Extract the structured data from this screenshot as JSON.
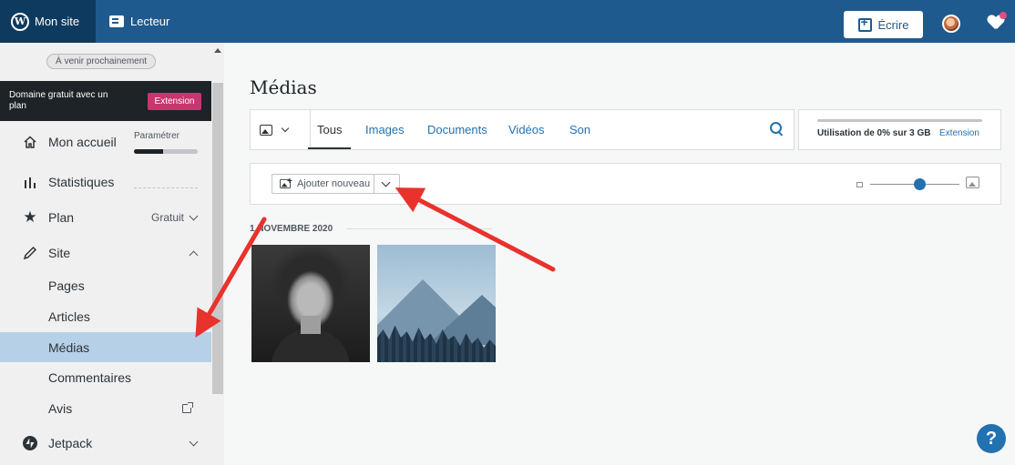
{
  "topbar": {
    "my_site": "Mon site",
    "reader": "Lecteur",
    "write": "Écrire"
  },
  "sidebar": {
    "upcoming_badge": "À venir prochainement",
    "domain_promo": {
      "text": "Domaine gratuit avec un plan",
      "button": "Extension"
    },
    "setup_label": "Paramétrer",
    "setup_progress": 0.45,
    "items": [
      {
        "label": "Mon accueil",
        "icon": "home-icon"
      },
      {
        "label": "Statistiques",
        "icon": "stats-icon"
      },
      {
        "label": "Plan",
        "icon": "star-icon",
        "right": "Gratuit"
      },
      {
        "label": "Site",
        "icon": "pencil-icon"
      }
    ],
    "site_subitems": [
      "Pages",
      "Articles",
      "Médias",
      "Commentaires",
      "Avis"
    ],
    "jetpack": "Jetpack"
  },
  "main": {
    "title": "Médias",
    "tabs": [
      "Tous",
      "Images",
      "Documents",
      "Vidéos",
      "Son"
    ],
    "active_tab": "Tous",
    "usage": {
      "text": "Utilisation de 0% sur 3 GB",
      "link": "Extension",
      "percent": 0
    },
    "add_new": "Ajouter nouveau",
    "zoom_level": 0.55,
    "date_group": "1 NOVEMBRE 2020",
    "media_items": [
      {
        "type": "image",
        "subject": "portrait"
      },
      {
        "type": "image",
        "subject": "mountains"
      }
    ]
  },
  "help": "?",
  "colors": {
    "topbar": "#1e5a8e",
    "accent": "#2271b1",
    "promo_button": "#c9356e",
    "active_item": "#b6d0e8",
    "annotation_arrow": "#e8322b"
  }
}
